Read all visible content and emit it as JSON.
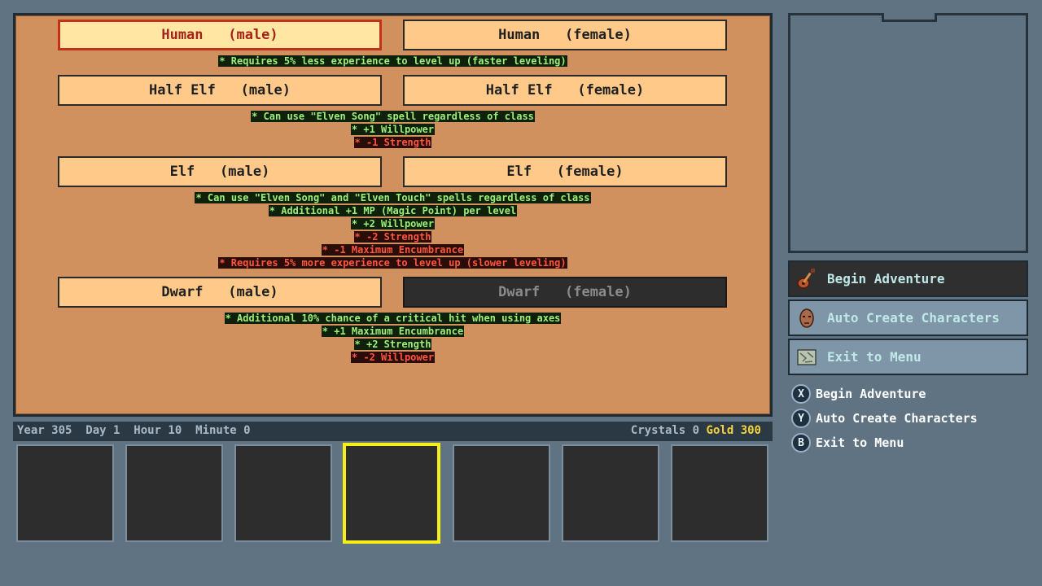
{
  "races": [
    {
      "male": "Human   (male)",
      "female": "Human   (female)",
      "selected": "male",
      "disabled": [],
      "traits": [
        {
          "text": "* Requires 5% less experience to level up (faster leveling)",
          "kind": "good"
        }
      ]
    },
    {
      "male": "Half Elf   (male)",
      "female": "Half Elf   (female)",
      "selected": null,
      "disabled": [],
      "traits": [
        {
          "text": "* Can use \"Elven Song\" spell regardless of class",
          "kind": "good"
        },
        {
          "text": "* +1 Willpower",
          "kind": "good"
        },
        {
          "text": "* -1 Strength",
          "kind": "bad"
        }
      ]
    },
    {
      "male": "Elf   (male)",
      "female": "Elf   (female)",
      "selected": null,
      "disabled": [],
      "traits": [
        {
          "text": "* Can use \"Elven Song\" and \"Elven Touch\" spells regardless of class",
          "kind": "good"
        },
        {
          "text": "* Additional +1 MP (Magic Point) per level",
          "kind": "good"
        },
        {
          "text": "* +2 Willpower",
          "kind": "good"
        },
        {
          "text": "* -2 Strength",
          "kind": "bad"
        },
        {
          "text": "* -1 Maximum Encumbrance",
          "kind": "bad"
        },
        {
          "text": "* Requires 5% more experience to level up (slower leveling)",
          "kind": "bad"
        }
      ]
    },
    {
      "male": "Dwarf   (male)",
      "female": "Dwarf   (female)",
      "selected": null,
      "disabled": [
        "female"
      ],
      "traits": [
        {
          "text": "* Additional 10% chance of a critical hit when using axes",
          "kind": "good"
        },
        {
          "text": "* +1 Maximum Encumbrance",
          "kind": "good"
        },
        {
          "text": "* +2 Strength",
          "kind": "good"
        },
        {
          "text": "* -2 Willpower",
          "kind": "bad"
        }
      ]
    }
  ],
  "status": {
    "time": "Year 305  Day 1  Hour 10  Minute 0",
    "crystals_label": "Crystals",
    "crystals": "0",
    "gold_label": "Gold",
    "gold": "300"
  },
  "party_slots": {
    "count": 7,
    "active_index": 3
  },
  "menu": [
    {
      "label": "Begin Adventure",
      "icon": "lute-icon",
      "style": "dark"
    },
    {
      "label": "Auto Create Characters",
      "icon": "face-icon",
      "style": "light"
    },
    {
      "label": "Exit to Menu",
      "icon": "map-icon",
      "style": "light"
    }
  ],
  "hints": [
    {
      "button": "X",
      "label": "Begin Adventure"
    },
    {
      "button": "Y",
      "label": "Auto Create Characters"
    },
    {
      "button": "B",
      "label": "Exit to Menu"
    }
  ],
  "colors": {
    "good_text": "#9cf07a",
    "bad_text": "#ff5640",
    "gold": "#f6d23a",
    "slot_active": "#f6ee17",
    "menu_dark": "#2f2f2f",
    "menu_light": "#7f96a8"
  }
}
